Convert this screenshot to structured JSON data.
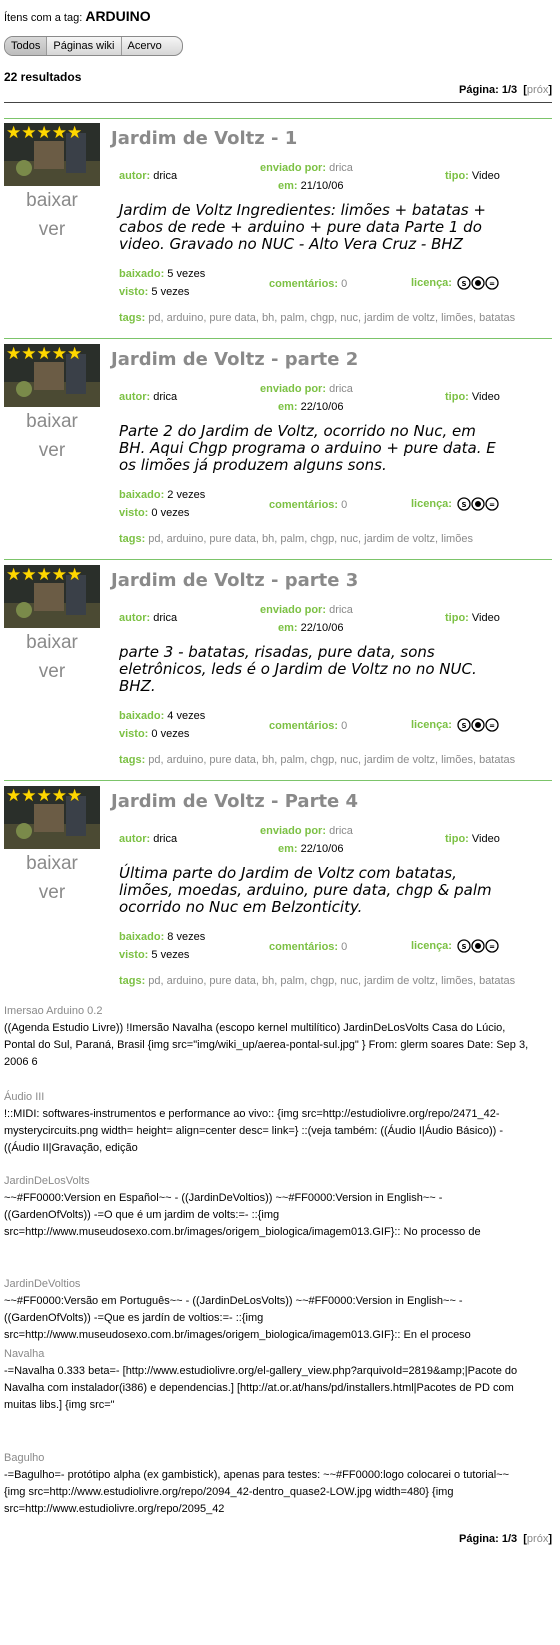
{
  "header": {
    "prefix": "Ítens com a tag:",
    "tag": "ARDUINO",
    "tabs": [
      "Todos",
      "Páginas wiki",
      "Acervo"
    ],
    "results": "22 resultados",
    "pager": {
      "label": "Página: 1/3",
      "open": "[",
      "next": "próx",
      "close": "]"
    }
  },
  "labels": {
    "autor": "autor:",
    "enviado": "enviado por:",
    "em": "em:",
    "tipo": "tipo:",
    "baixado": "baixado:",
    "visto": "visto:",
    "comentarios": "comentários:",
    "licenca": "licença:",
    "tags": "tags:",
    "baixar": "baixar",
    "ver": "ver"
  },
  "entries": [
    {
      "title": "Jardim de Voltz - 1",
      "autor": "drica",
      "enviado": "drica",
      "em": "21/10/06",
      "tipo": "Video",
      "desc": "Jardim de Voltz Ingredientes: limões + batatas + cabos de rede + arduino + pure data Parte 1 do video. Gravado no NUC - Alto Vera Cruz - BHZ",
      "baixado": "5 vezes",
      "visto": "5 vezes",
      "comentarios": "0",
      "tags": "pd, arduino, pure data, bh, palm, chgp, nuc, jardim de voltz, limões, batatas",
      "stars": "★★★★★"
    },
    {
      "title": "Jardim de Voltz - parte 2",
      "autor": "drica",
      "enviado": "drica",
      "em": "22/10/06",
      "tipo": "Video",
      "desc": "Parte 2 do Jardim de Voltz, ocorrido no Nuc, em BH. Aqui Chgp programa o arduino + pure data. E os limões já produzem alguns sons.",
      "baixado": "2 vezes",
      "visto": "0 vezes",
      "comentarios": "0",
      "tags": "pd, arduino, pure data, bh, palm, chgp, nuc, jardim de voltz, limões",
      "stars": "★★★★★"
    },
    {
      "title": "Jardim de Voltz - parte 3",
      "autor": "drica",
      "enviado": "drica",
      "em": "22/10/06",
      "tipo": "Video",
      "desc": "parte 3 - batatas, risadas, pure data, sons eletrônicos, leds é o Jardim de Voltz no no NUC. BHZ.",
      "baixado": "4 vezes",
      "visto": "0 vezes",
      "comentarios": "0",
      "tags": "pd, arduino, pure data, bh, palm, chgp, nuc, jardim de voltz, limões, batatas",
      "stars": "★★★★★"
    },
    {
      "title": "Jardim de Voltz - Parte 4",
      "autor": "drica",
      "enviado": "drica",
      "em": "22/10/06",
      "tipo": "Video",
      "desc": "Última parte do Jardim de Voltz com batatas, limões, moedas, arduino, pure data, chgp & palm ocorrido no Nuc em Belzonticity.",
      "baixado": "8 vezes",
      "visto": "5 vezes",
      "comentarios": "0",
      "tags": "pd, arduino, pure data, bh, palm, chgp, nuc, jardim de voltz, limões, batatas",
      "stars": "★★★★★"
    }
  ],
  "wiki": [
    {
      "title": "Imersao Arduino 0.2",
      "body": "((Agenda Estudio Livre)) !Imersão Navalha (escopo kernel multilítico) JardinDeLosVolts Casa do Lúcio, Pontal do Sul, Paraná, Brasil {img src=\"img/wiki_up/aerea-pontal-sul.jpg\" } From: glerm soares Date: Sep 3, 2006 6"
    },
    {
      "title": "Áudio III",
      "body": "!::MIDI: softwares-instrumentos e performance ao vivo:: {img src=http://estudiolivre.org/repo/2471_42-mysterycircuits.png width= height= align=center desc= link=} ::(veja também: ((Áudio I|Áudio Básico)) - ((Áudio II|Gravação, edição"
    },
    {
      "title": "JardinDeLosVolts",
      "body": "~~#FF0000:Version en Español~~ - ((JardinDeVoltios)) ~~#FF0000:Version in English~~ - ((GardenOfVolts)) -=O que é um jardim de volts:=- ::{img src=http://www.museudosexo.com.br/images/origem_biologica/imagem013.GIF}:: No processo de"
    },
    {
      "title": "JardinDeVoltios",
      "body": "~~#FF0000:Versão em Português~~ - ((JardinDeLosVolts)) ~~#FF0000:Version in English~~ - ((GardenOfVolts)) -=Que es jardín de voltios:=- ::{img src=http://www.museudosexo.com.br/images/origem_biologica/imagem013.GIF}:: En el proceso"
    },
    {
      "title": "Navalha",
      "body": "-=Navalha 0.333 beta=- [http://www.estudiolivre.org/el-gallery_view.php?arquivoId=2819&amp;|Pacote do Navalha com instalador(i386) e dependencias.] [http://at.or.at/hans/pd/installers.html|Pacotes de PD com muitas libs.] {img src=\""
    },
    {
      "title": "Bagulho",
      "body": "-=Bagulho=- protótipo alpha (ex gambistick), apenas para testes: ~~#FF0000:logo colocarei o tutorial~~ {img src=http://www.estudiolivre.org/repo/2094_42-dentro_quase2-LOW.jpg width=480} {img src=http://www.estudiolivre.org/repo/2095_42"
    }
  ],
  "colors": {
    "label_green": "#7cc144",
    "rule_green": "#7cc46a",
    "muted": "#8a8a8a",
    "star": "#ffd700"
  }
}
